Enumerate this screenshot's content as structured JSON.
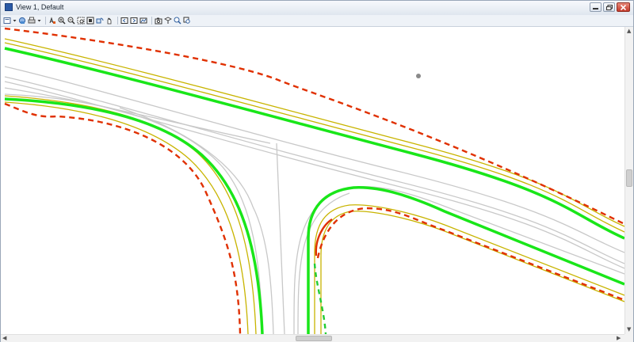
{
  "window": {
    "title": "View 1, Default",
    "buttons": [
      "minimize",
      "restore",
      "close"
    ]
  },
  "toolbar": {
    "icons": [
      "view-attributes-icon",
      "dropdown-arrow-icon",
      "view-display-icon",
      "print-icon",
      "dropdown-arrow-icon",
      "update-view-icon",
      "zoom-in-icon",
      "zoom-out-icon",
      "window-area-icon",
      "fit-view-icon",
      "rotate-view-icon",
      "pan-view-icon",
      "view-previous-icon",
      "view-next-icon",
      "copy-view-icon",
      "camera-icon",
      "clip-volume-icon",
      "clip-mask-icon",
      "find-icon"
    ]
  },
  "colors": {
    "centerline_green": "#19e619",
    "edge_yellow": "#c8b400",
    "boundary_red": "#e03000",
    "road_gray": "#c8c8c8",
    "marker_gray": "#8a8a8a",
    "boundary_green_dashed": "#22cc33"
  }
}
